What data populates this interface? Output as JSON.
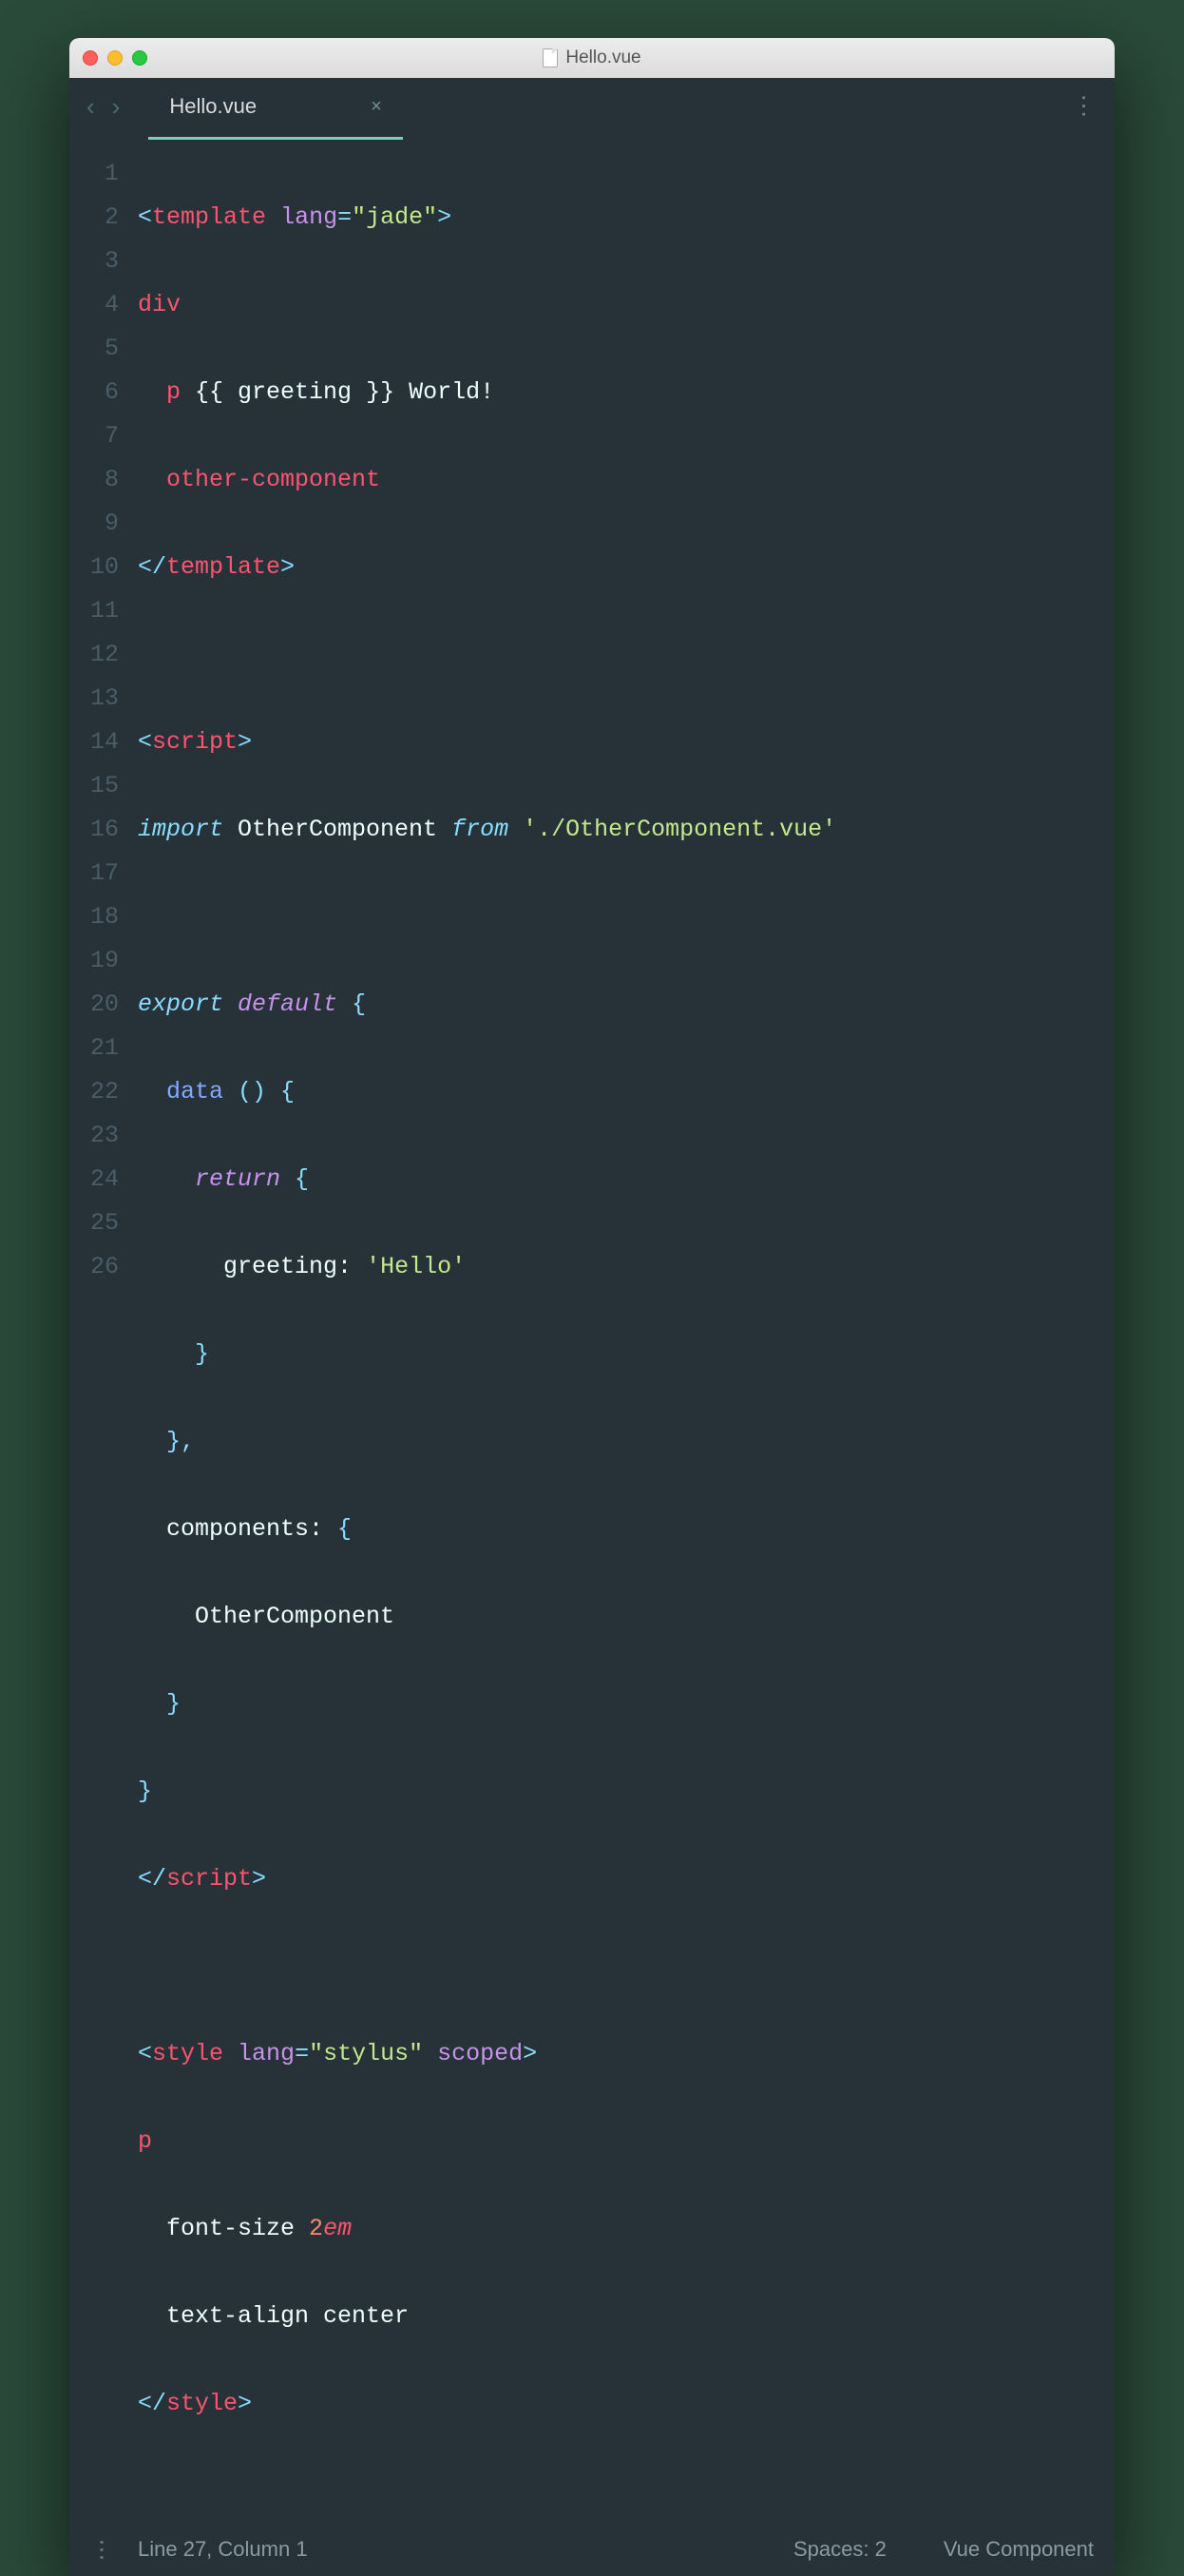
{
  "window": {
    "title": "Hello.vue"
  },
  "tab": {
    "filename": "Hello.vue",
    "close": "×"
  },
  "gutter": [
    "1",
    "2",
    "3",
    "4",
    "5",
    "6",
    "7",
    "8",
    "9",
    "10",
    "11",
    "12",
    "13",
    "14",
    "15",
    "16",
    "17",
    "18",
    "19",
    "20",
    "21",
    "22",
    "23",
    "24",
    "25",
    "26"
  ],
  "code": {
    "l1": {
      "a": "<",
      "b": "template",
      "c": " ",
      "d": "lang",
      "e": "=",
      "f": "\"jade\"",
      "g": ">"
    },
    "l2": {
      "a": "div"
    },
    "l3": {
      "indent": "  ",
      "a": "p",
      "b": " {{ greeting }} World!"
    },
    "l4": {
      "indent": "  ",
      "a": "other-component"
    },
    "l5": {
      "a": "</",
      "b": "template",
      "c": ">"
    },
    "l7": {
      "a": "<",
      "b": "script",
      "c": ">"
    },
    "l8": {
      "a": "import",
      "b": " OtherComponent ",
      "c": "from",
      "d": " ",
      "e": "'./OtherComponent.vue'"
    },
    "l10": {
      "a": "export",
      "b": " ",
      "c": "default",
      "d": " {"
    },
    "l11": {
      "indent": "  ",
      "a": "data",
      "b": " () {"
    },
    "l12": {
      "indent": "    ",
      "a": "return",
      "b": " {"
    },
    "l13": {
      "indent": "      ",
      "a": "greeting:",
      "b": " ",
      "c": "'Hello'"
    },
    "l14": {
      "indent": "    ",
      "a": "}"
    },
    "l15": {
      "indent": "  ",
      "a": "},"
    },
    "l16": {
      "indent": "  ",
      "a": "components:",
      "b": " {"
    },
    "l17": {
      "indent": "    ",
      "a": "OtherComponent"
    },
    "l18": {
      "indent": "  ",
      "a": "}"
    },
    "l19": {
      "a": "}"
    },
    "l20": {
      "a": "</",
      "b": "script",
      "c": ">"
    },
    "l22": {
      "a": "<",
      "b": "style",
      "c": " ",
      "d": "lang",
      "e": "=",
      "f": "\"stylus\"",
      "g": " ",
      "h": "scoped",
      "i": ">"
    },
    "l23": {
      "a": "p"
    },
    "l24": {
      "indent": "  ",
      "a": "font-size ",
      "b": "2",
      "c": "em"
    },
    "l25": {
      "indent": "  ",
      "a": "text-align center"
    },
    "l26": {
      "a": "</",
      "b": "style",
      "c": ">"
    }
  },
  "status": {
    "position": "Line 27, Column 1",
    "spaces": "Spaces: 2",
    "syntax": "Vue Component"
  }
}
